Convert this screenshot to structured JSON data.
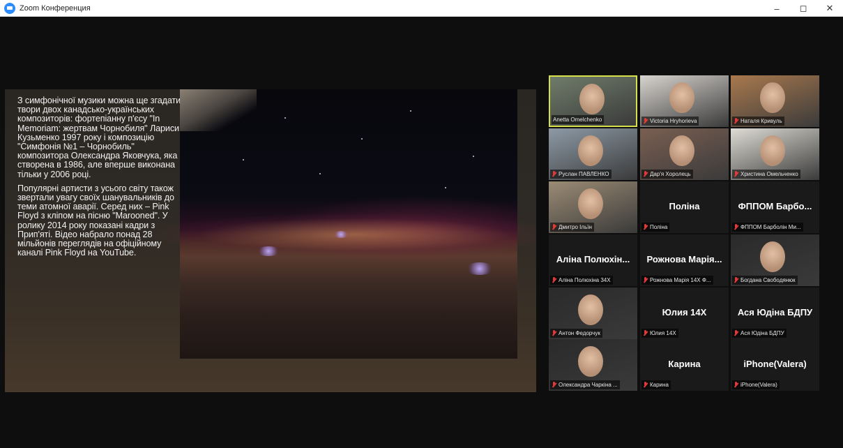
{
  "window": {
    "title": "Zoom Конференция",
    "minimize": "–",
    "maximize": "◻",
    "close": "✕"
  },
  "slide": {
    "paragraphs": [
      "З симфонічної музики можна ще згадати твори двох канадсько-українських композиторів: фортепіанну п'єсу \"In Memoriam: жертвам Чорнобиля\" Лариси Кузьменко 1997 року і композицію \"Симфонія №1 – Чорнобиль\" композитора Олександра Яковчука, яка створена в 1986, але вперше виконана тільки у 2006 році.",
      "Популярні артисти з усього світу також звертали увагу своїх шанувальників до теми атомної аварії. Серед них – Pink Floyd з кліпом на пісню \"Marooned\". У ролику 2014 року показані кадри з Прип'яті. Відео набрало понад 28 мільйонів переглядів на офіційному каналі Pink Floyd на YouTube."
    ]
  },
  "participants": [
    {
      "label": "Anetta Omelchenko",
      "big": "",
      "muted": false,
      "active": true,
      "video": true,
      "bg": "#6f7c6a"
    },
    {
      "label": "Victoria Hryhorieva",
      "big": "",
      "muted": true,
      "active": false,
      "video": true,
      "bg": "#d8d4cf"
    },
    {
      "label": "Наталя Кривуль",
      "big": "",
      "muted": true,
      "active": false,
      "video": true,
      "bg": "#a9794e"
    },
    {
      "label": "Руслан ПАВЛЕНКО",
      "big": "",
      "muted": true,
      "active": false,
      "video": true,
      "bg": "#8d9aa6"
    },
    {
      "label": "Дар'я Хоролець",
      "big": "",
      "muted": true,
      "active": false,
      "video": true,
      "bg": "#7a5f52"
    },
    {
      "label": "Христина Омельченко",
      "big": "",
      "muted": true,
      "active": false,
      "video": true,
      "bg": "#dedcd4"
    },
    {
      "label": "Дмитро Ільїн",
      "big": "",
      "muted": true,
      "active": false,
      "video": true,
      "bg": "#9b8b74"
    },
    {
      "label": "Поліна",
      "big": "Поліна",
      "muted": true,
      "active": false,
      "video": false,
      "bg": "#1a1a1a"
    },
    {
      "label": "ФППОМ Барболін Ми...",
      "big": "ФППОМ Барбо...",
      "muted": true,
      "active": false,
      "video": false,
      "bg": "#1a1a1a"
    },
    {
      "label": "Аліна Полюхіна 34Х",
      "big": "Аліна Полюхін...",
      "muted": true,
      "active": false,
      "video": false,
      "bg": "#1a1a1a"
    },
    {
      "label": "Рожнова Марія 14Х Ф...",
      "big": "Рожнова Марія...",
      "muted": true,
      "active": false,
      "video": false,
      "bg": "#1a1a1a"
    },
    {
      "label": "Богдана Свободянюк",
      "big": "",
      "muted": true,
      "active": false,
      "video": true,
      "bg": "#2a2a2a"
    },
    {
      "label": "Антон Федорчук",
      "big": "",
      "muted": true,
      "active": false,
      "video": true,
      "bg": "#2a2a2a"
    },
    {
      "label": "Юлия 14Х",
      "big": "Юлия 14Х",
      "muted": true,
      "active": false,
      "video": false,
      "bg": "#1a1a1a"
    },
    {
      "label": "Ася Юдіна БДПУ",
      "big": "Ася Юдіна БДПУ",
      "muted": true,
      "active": false,
      "video": false,
      "bg": "#1a1a1a"
    },
    {
      "label": "Олександра Чаркіна ...",
      "big": "",
      "muted": true,
      "active": false,
      "video": true,
      "bg": "#2a2a2a"
    },
    {
      "label": "Карина",
      "big": "Карина",
      "muted": true,
      "active": false,
      "video": false,
      "bg": "#1a1a1a"
    },
    {
      "label": "iPhone(Valera)",
      "big": "iPhone(Valera)",
      "muted": true,
      "active": false,
      "video": false,
      "bg": "#1a1a1a"
    }
  ]
}
